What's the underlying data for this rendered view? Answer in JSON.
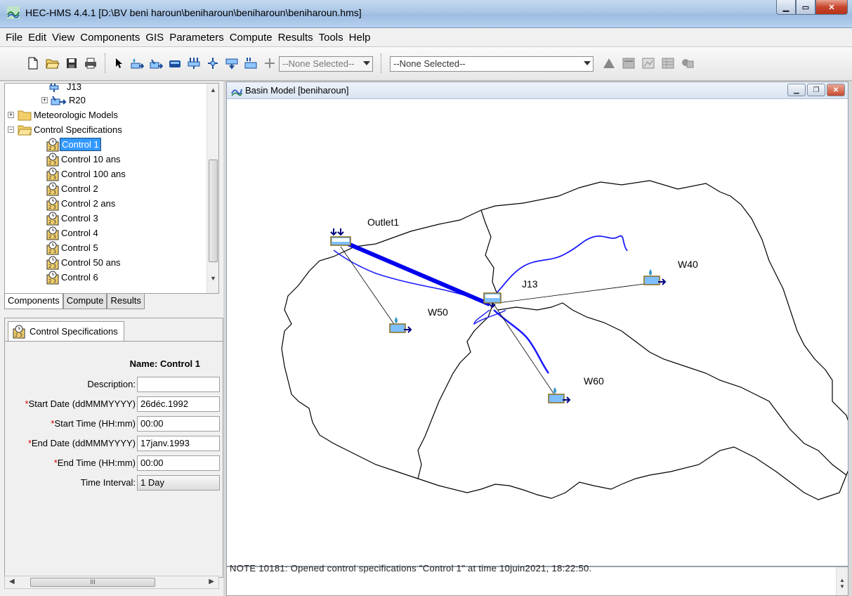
{
  "window": {
    "title": "HEC-HMS 4.4.1 [D:\\BV  beni haroun\\beniharoun\\beniharoun\\beniharoun.hms]"
  },
  "menu": [
    "File",
    "Edit",
    "View",
    "Components",
    "GIS",
    "Parameters",
    "Compute",
    "Results",
    "Tools",
    "Help"
  ],
  "toolbar": {
    "combo1": "--None Selected--",
    "combo2": "--None Selected--"
  },
  "tree": {
    "items": [
      {
        "label": "J13",
        "kind": "junction"
      },
      {
        "label": "R20",
        "kind": "reach"
      },
      {
        "label": "Meteorologic Models",
        "kind": "folder"
      },
      {
        "label": "Control Specifications",
        "kind": "folder"
      },
      {
        "label": "Control 1",
        "kind": "control",
        "selected": true
      },
      {
        "label": "Control 10 ans",
        "kind": "control"
      },
      {
        "label": "Control 100 ans",
        "kind": "control"
      },
      {
        "label": "Control 2",
        "kind": "control"
      },
      {
        "label": "Control 2 ans",
        "kind": "control"
      },
      {
        "label": "Control 3",
        "kind": "control"
      },
      {
        "label": "Control 4",
        "kind": "control"
      },
      {
        "label": "Control 5",
        "kind": "control"
      },
      {
        "label": "Control 50 ans",
        "kind": "control"
      },
      {
        "label": "Control 6",
        "kind": "control"
      }
    ]
  },
  "tabs": [
    "Components",
    "Compute",
    "Results"
  ],
  "props": {
    "tab_label": "Control Specifications",
    "name_line": "Name: Control 1",
    "description_label": "Description:",
    "description_value": "",
    "start_date_label": "Start Date (ddMMMYYYY)",
    "start_date_value": "26déc.1992",
    "start_time_label": "Start Time (HH:mm)",
    "start_time_value": "00:00",
    "end_date_label": "End Date (ddMMMYYYY)",
    "end_date_value": "17janv.1993",
    "end_time_label": "End Time (HH:mm)",
    "end_time_value": "00:00",
    "interval_label": "Time Interval:",
    "interval_value": "1 Day",
    "required_mark": "*"
  },
  "basin": {
    "title": "Basin Model [beniharoun]",
    "labels": {
      "outlet": "Outlet1",
      "junction": "J13",
      "w40": "W40",
      "w50": "W50",
      "w60": "W60"
    }
  },
  "console": {
    "message": "NOTE 10181:  Opened control specifications \"Control 1\" at time 10juin2021, 18:22:50."
  },
  "colors": {
    "selection": "#3399ff",
    "river": "#0000ff",
    "required": "#d00000"
  }
}
